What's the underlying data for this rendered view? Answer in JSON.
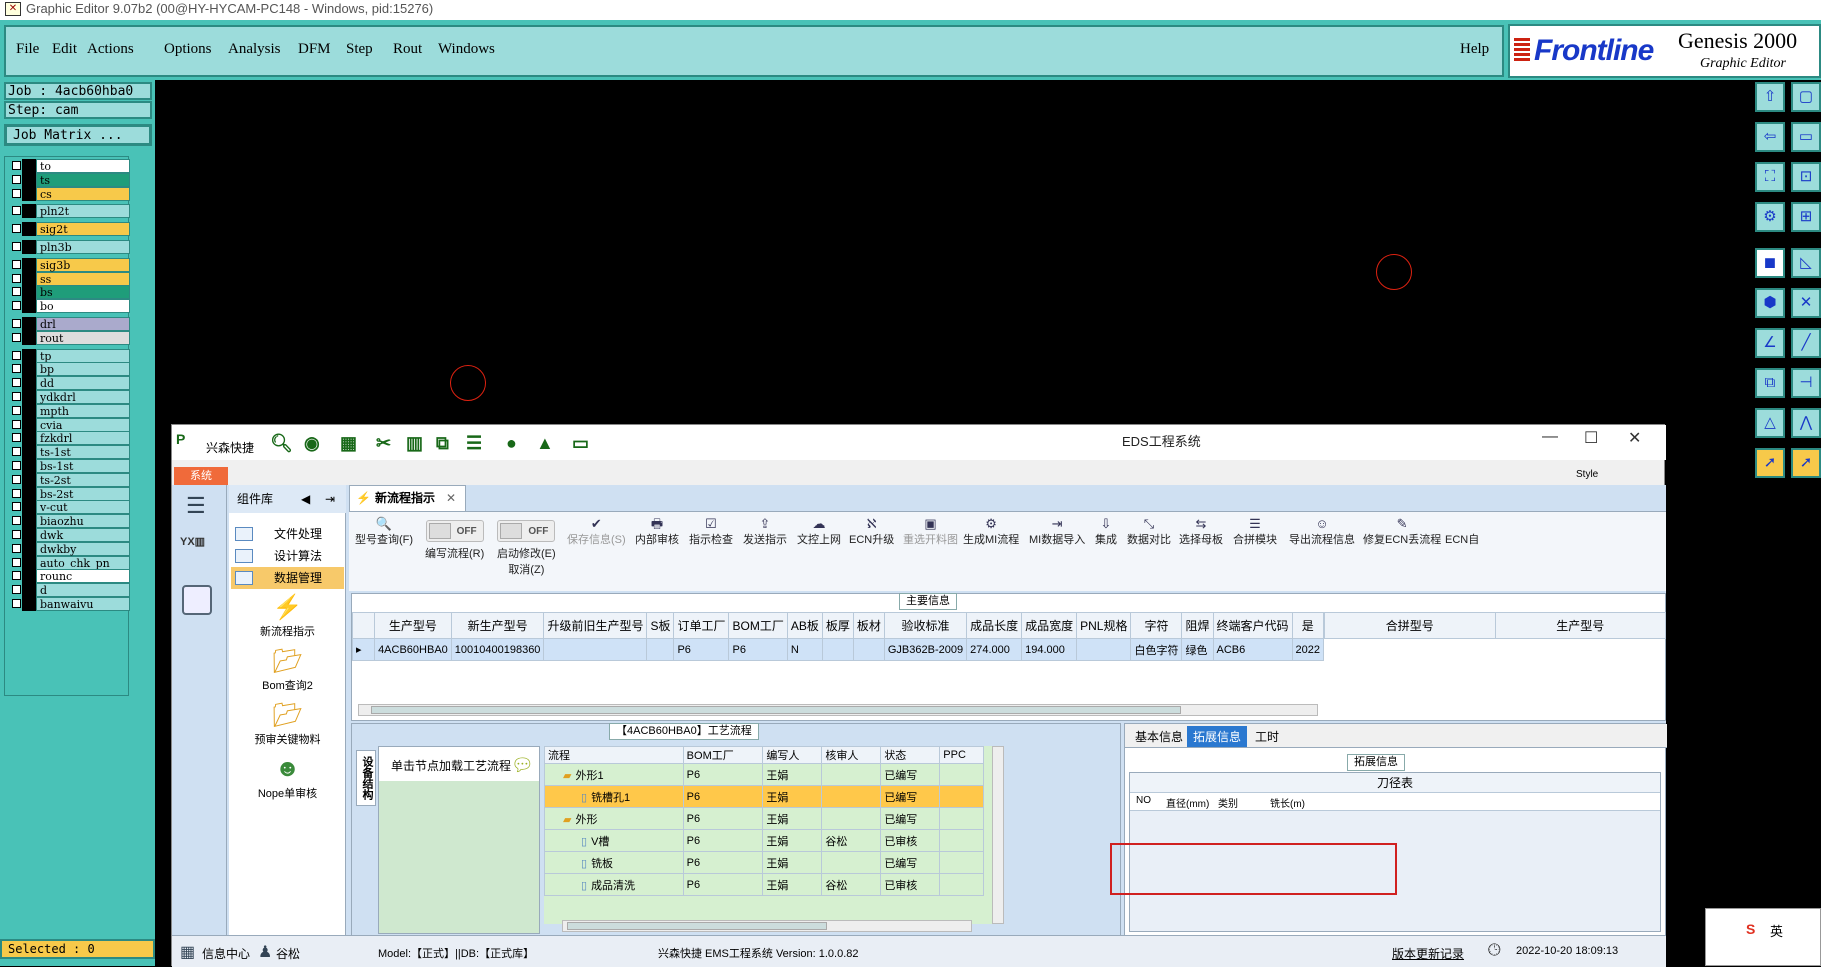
{
  "app": {
    "title": "Graphic Editor 9.07b2 (00@HY-HYCAM-PC148 - Windows, pid:15276)"
  },
  "menu": {
    "items": [
      "File",
      "Edit",
      "Actions",
      "Options",
      "Analysis",
      "DFM",
      "Step",
      "Rout",
      "Windows"
    ],
    "help": "Help"
  },
  "logo": {
    "brand": "Frontline",
    "product": "Genesis 2000",
    "sub": "Graphic Editor"
  },
  "job": {
    "job_line": "Job : 4acb60hba0",
    "step_line": "Step: cam",
    "matrix_btn": "Job Matrix ..."
  },
  "layers": [
    {
      "name": "to",
      "color": "#ffffff",
      "mark": "⇙"
    },
    {
      "name": "ts",
      "color": "#1f9d7a",
      "mark": "⇙"
    },
    {
      "name": "cs",
      "color": "#f7c94a",
      "mark": "⇙"
    },
    {
      "name": "pln2t",
      "color": "#9cdcdb",
      "mark": ""
    },
    {
      "name": "sig2t",
      "color": "#f7c94a",
      "mark": "⇙"
    },
    {
      "name": "pln3b",
      "color": "#9cdcdb",
      "mark": ""
    },
    {
      "name": "sig3b",
      "color": "#f7c94a",
      "mark": "⇙"
    },
    {
      "name": "ss",
      "color": "#f7c94a",
      "mark": "⇙"
    },
    {
      "name": "bs",
      "color": "#1f9d7a",
      "mark": "⇙"
    },
    {
      "name": "bo",
      "color": "#ffffff",
      "mark": "⇙"
    },
    {
      "name": "drl",
      "color": "#aac",
      "mark": ""
    },
    {
      "name": "rout",
      "color": "#ddd",
      "mark": ""
    },
    {
      "name": "tp",
      "color": "#9cdcdb",
      "mark": "⇙"
    },
    {
      "name": "bp",
      "color": "#9cdcdb",
      "mark": "⇙"
    },
    {
      "name": "dd",
      "color": "#9cdcdb",
      "mark": "⇙"
    },
    {
      "name": "ydkdrl",
      "color": "#9cdcdb",
      "mark": ""
    },
    {
      "name": "mpth",
      "color": "#9cdcdb",
      "mark": ""
    },
    {
      "name": "cvia",
      "color": "#9cdcdb",
      "mark": ""
    },
    {
      "name": "fzkdrl",
      "color": "#9cdcdb",
      "mark": ""
    },
    {
      "name": "ts-1st",
      "color": "#9cdcdb",
      "mark": ""
    },
    {
      "name": "bs-1st",
      "color": "#9cdcdb",
      "mark": ""
    },
    {
      "name": "ts-2st",
      "color": "#9cdcdb",
      "mark": ""
    },
    {
      "name": "bs-2st",
      "color": "#9cdcdb",
      "mark": ""
    },
    {
      "name": "v-cut",
      "color": "#9cdcdb",
      "mark": ""
    },
    {
      "name": "biaozhu",
      "color": "#9cdcdb",
      "mark": ""
    },
    {
      "name": "dwk",
      "color": "#9cdcdb",
      "mark": ""
    },
    {
      "name": "dwkby",
      "color": "#9cdcdb",
      "mark": ""
    },
    {
      "name": "auto_chk_pn",
      "color": "#9cdcdb",
      "mark": ""
    },
    {
      "name": "rounc",
      "color": "#ffffff",
      "mark": "■"
    },
    {
      "name": "d",
      "color": "#9cdcdb",
      "mark": ""
    },
    {
      "name": "banwaivu",
      "color": "#9cdcdb",
      "mark": ""
    }
  ],
  "selected": "Selected : 0",
  "eds": {
    "title": "EDS工程系统",
    "quick_label": "兴森快捷",
    "sys_tab": "系统",
    "style_label": "Style",
    "comp_header": "组件库",
    "comp_items": [
      "文件处理",
      "设计算法",
      "数据管理"
    ],
    "big_items": [
      "新流程指示",
      "Bom查询2",
      "预审关键物料",
      "Nope单审核"
    ],
    "doc_tab": "新流程指示",
    "ribbon": [
      {
        "label": "型号查询(F)",
        "icon": "🔍",
        "dis": false
      },
      {
        "label": "编写流程(R)",
        "icon": "",
        "dis": false,
        "toggle": "OFF"
      },
      {
        "label": "启动修改(E)\n取消(Z)",
        "icon": "",
        "dis": false,
        "toggle": "OFF"
      },
      {
        "label": "保存信息(S)",
        "icon": "✔",
        "dis": true
      },
      {
        "label": "内部审核",
        "icon": "🖶",
        "dis": false
      },
      {
        "label": "指示检查",
        "icon": "☑",
        "dis": false
      },
      {
        "label": "发送指示",
        "icon": "⇪",
        "dis": false
      },
      {
        "label": "文控上网",
        "icon": "☁",
        "dis": false
      },
      {
        "label": "ECN升级",
        "icon": "ℵ",
        "dis": false
      },
      {
        "label": "重选开料图",
        "icon": "▣",
        "dis": true
      },
      {
        "label": "生成MI流程",
        "icon": "⚙",
        "dis": false
      },
      {
        "label": "MI数据导入",
        "icon": "⇥",
        "dis": false
      },
      {
        "label": "集成",
        "icon": "⇩",
        "dis": false
      },
      {
        "label": "数据对比",
        "icon": "⤡",
        "dis": false
      },
      {
        "label": "选择母板",
        "icon": "⇆",
        "dis": false
      },
      {
        "label": "合拼模块",
        "icon": "☰",
        "dis": false
      },
      {
        "label": "导出流程信息",
        "icon": "☺",
        "dis": false
      },
      {
        "label": "修复ECN丢流程",
        "icon": "✎",
        "dis": false
      },
      {
        "label": "ECN自",
        "icon": "",
        "dis": false
      }
    ],
    "main_info": {
      "title": "主要信息",
      "columns": [
        "生产型号",
        "新生产型号",
        "升级前旧生产型号",
        "S板",
        "订单工厂",
        "BOM工厂",
        "AB板",
        "板厚",
        "板材",
        "验收标准",
        "成品长度",
        "成品宽度",
        "PNL规格",
        "字符",
        "阻焊",
        "终端客户代码",
        "是"
      ],
      "row": [
        "4ACB60HBA0",
        "10010400198360",
        "",
        "",
        "P6",
        "P6",
        "N",
        "",
        "",
        "GJB362B-2009",
        "274.000",
        "194.000",
        "",
        "白色字符",
        "绿色",
        "ACB6",
        "2022"
      ],
      "right_columns": [
        "合拼型号",
        "生产型号"
      ]
    },
    "flow": {
      "title": "【4ACB60HBA0】工艺流程",
      "vertical_tab": "设备结构",
      "hint": "单击节点加载工艺流程",
      "columns": [
        "流程",
        "BOM工厂",
        "编写人",
        "核审人",
        "状态",
        "PPC"
      ],
      "rows": [
        {
          "name": "外形1",
          "indent": 1,
          "folder": true,
          "bom": "P6",
          "writer": "王娟",
          "reviewer": "",
          "status": "已编写",
          "hl": false
        },
        {
          "name": "铣槽孔1",
          "indent": 2,
          "folder": false,
          "bom": "P6",
          "writer": "王娟",
          "reviewer": "",
          "status": "已编写",
          "hl": true
        },
        {
          "name": "外形",
          "indent": 1,
          "folder": true,
          "bom": "P6",
          "writer": "王娟",
          "reviewer": "",
          "status": "已编写",
          "hl": false
        },
        {
          "name": "V槽",
          "indent": 2,
          "folder": false,
          "bom": "P6",
          "writer": "王娟",
          "reviewer": "谷松",
          "status": "已审核",
          "hl": false
        },
        {
          "name": "铣板",
          "indent": 2,
          "folder": false,
          "bom": "P6",
          "writer": "王娟",
          "reviewer": "",
          "status": "已编写",
          "hl": false
        },
        {
          "name": "成品清洗",
          "indent": 2,
          "folder": false,
          "bom": "P6",
          "writer": "王娟",
          "reviewer": "谷松",
          "status": "已审核",
          "hl": false
        }
      ]
    },
    "ext": {
      "tabs": [
        "基本信息",
        "拓展信息",
        "工时"
      ],
      "title": "拓展信息",
      "table_title": "刀径表",
      "columns": [
        "NO",
        "直径(mm)",
        "类别",
        "铣长(m)"
      ]
    },
    "status": {
      "info_center": "信息中心",
      "user": "谷松",
      "model": "Model:【正式】||DB:【正式库】",
      "version": "兴森快捷 EMS工程系统 Version: 1.0.0.82",
      "changelog": "版本更新记录",
      "datetime": "2022-10-20 18:09:13"
    }
  },
  "ime": {
    "label": "英"
  }
}
